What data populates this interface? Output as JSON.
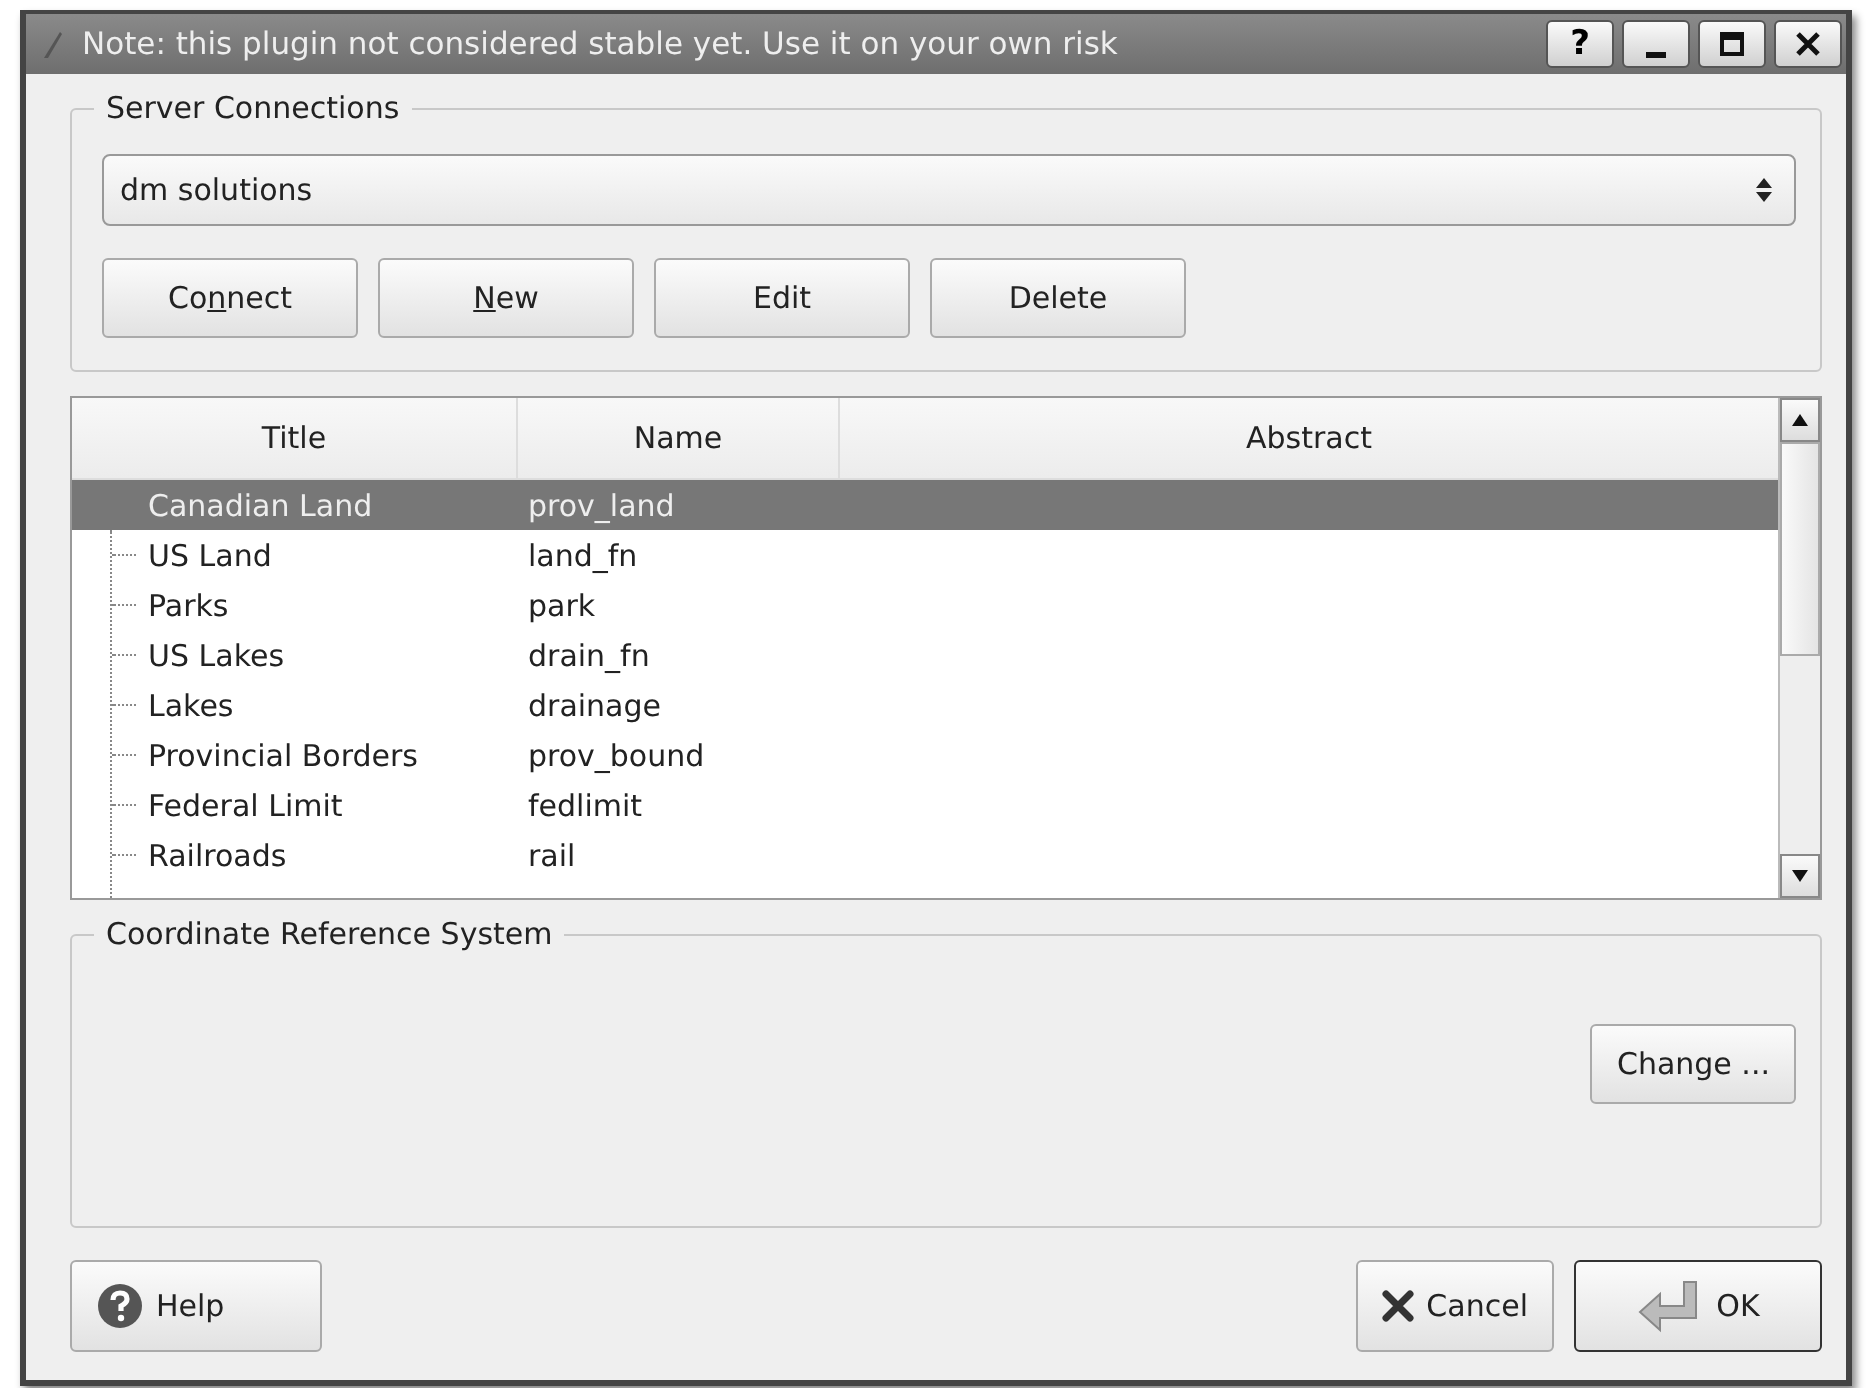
{
  "window": {
    "title": "Note: this plugin not considered stable yet. Use it on your own risk",
    "title_buttons": [
      "?"
    ]
  },
  "server_connections": {
    "label": "Server Connections",
    "connection": "dm solutions",
    "buttons": [
      {
        "before": "Co",
        "mnemonic": "n",
        "after": "nect"
      },
      {
        "mnemonic": "N",
        "after": "ew"
      },
      {
        "before": "Edit"
      },
      {
        "before": "Delete"
      }
    ]
  },
  "layers": {
    "columns": [
      "Title",
      "Name",
      "Abstract"
    ],
    "rows": [
      {
        "title": "Canadian Land",
        "name": "prov_land",
        "selected": true
      },
      {
        "title": "US Land",
        "name": "land_fn",
        "selected": false
      },
      {
        "title": "Parks",
        "name": "park",
        "selected": false
      },
      {
        "title": "US Lakes",
        "name": "drain_fn",
        "selected": false
      },
      {
        "title": "Lakes",
        "name": "drainage",
        "selected": false
      },
      {
        "title": "Provincial Borders",
        "name": "prov_bound",
        "selected": false
      },
      {
        "title": "Federal Limit",
        "name": "fedlimit",
        "selected": false
      },
      {
        "title": "Railroads",
        "name": "rail",
        "selected": false
      }
    ]
  },
  "crs": {
    "label": "Coordinate Reference System",
    "button": "Change ..."
  },
  "footer": {
    "help": "Help",
    "cancel": "Cancel",
    "ok": "OK"
  }
}
